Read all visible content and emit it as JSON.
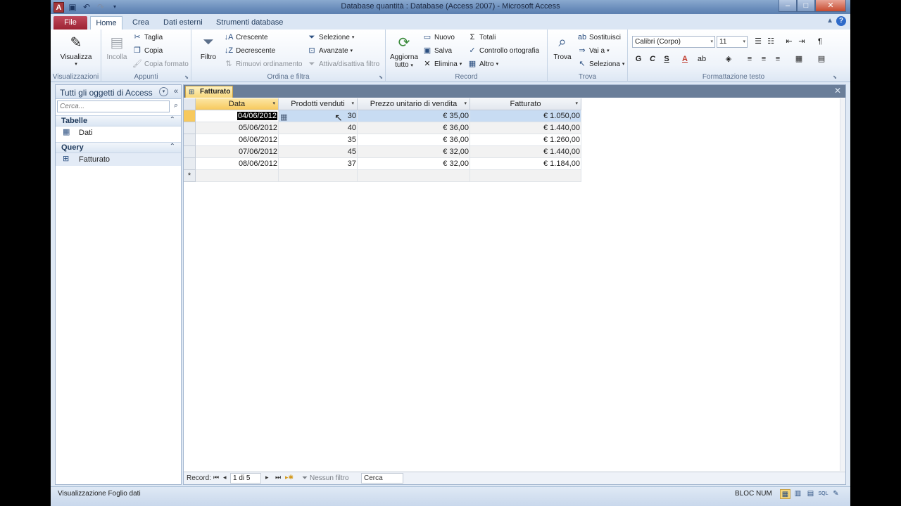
{
  "window": {
    "title": "Database quantità : Database (Access 2007)  -  Microsoft Access",
    "app_icon": "A",
    "controls": {
      "min": "–",
      "max": "□",
      "close": "✕"
    }
  },
  "tabs": {
    "file": "File",
    "home": "Home",
    "crea": "Crea",
    "dati_esterni": "Dati esterni",
    "strumenti": "Strumenti database"
  },
  "ribbon": {
    "visualizzazioni": {
      "label": "Visualizzazioni",
      "visualizza": "Visualizza"
    },
    "appunti": {
      "label": "Appunti",
      "incolla": "Incolla",
      "taglia": "Taglia",
      "copia": "Copia",
      "copia_formato": "Copia formato"
    },
    "ordina": {
      "label": "Ordina e filtra",
      "filtro": "Filtro",
      "crescente": "Crescente",
      "decrescente": "Decrescente",
      "rimuovi": "Rimuovi ordinamento",
      "selezione": "Selezione",
      "avanzate": "Avanzate",
      "attiva": "Attiva/disattiva filtro"
    },
    "record": {
      "label": "Record",
      "aggiorna_line1": "Aggiorna",
      "aggiorna_line2": "tutto",
      "nuovo": "Nuovo",
      "salva": "Salva",
      "elimina": "Elimina",
      "totali": "Totali",
      "controllo": "Controllo ortografia",
      "altro": "Altro"
    },
    "trova": {
      "label": "Trova",
      "trova": "Trova",
      "sostituisci": "Sostituisci",
      "vai_a": "Vai a",
      "seleziona": "Seleziona"
    },
    "formattazione": {
      "label": "Formattazione testo",
      "font": "Calibri (Corpo)",
      "size": "11",
      "bold": "G",
      "italic": "C",
      "underline": "S"
    }
  },
  "nav": {
    "header": "Tutti gli oggetti di Access",
    "search_placeholder": "Cerca...",
    "groups": [
      {
        "title": "Tabelle",
        "items": [
          "Dati"
        ]
      },
      {
        "title": "Query",
        "items": [
          "Fatturato"
        ]
      }
    ]
  },
  "document": {
    "tab": "Fatturato",
    "columns": [
      "Data",
      "Prodotti venduti",
      "Prezzo unitario di vendita",
      "Fatturato"
    ],
    "rows": [
      [
        "04/06/2012",
        "30",
        "€ 35,00",
        "€ 1.050,00"
      ],
      [
        "05/06/2012",
        "40",
        "€ 36,00",
        "€ 1.440,00"
      ],
      [
        "06/06/2012",
        "35",
        "€ 36,00",
        "€ 1.260,00"
      ],
      [
        "07/06/2012",
        "45",
        "€ 32,00",
        "€ 1.440,00"
      ],
      [
        "08/06/2012",
        "37",
        "€ 32,00",
        "€ 1.184,00"
      ]
    ],
    "new_row_marker": "*"
  },
  "record_nav": {
    "label": "Record:",
    "position": "1 di 5",
    "filter": "Nessun filtro",
    "search": "Cerca"
  },
  "status": {
    "view": "Visualizzazione Foglio dati",
    "num": "BLOC NUM"
  }
}
